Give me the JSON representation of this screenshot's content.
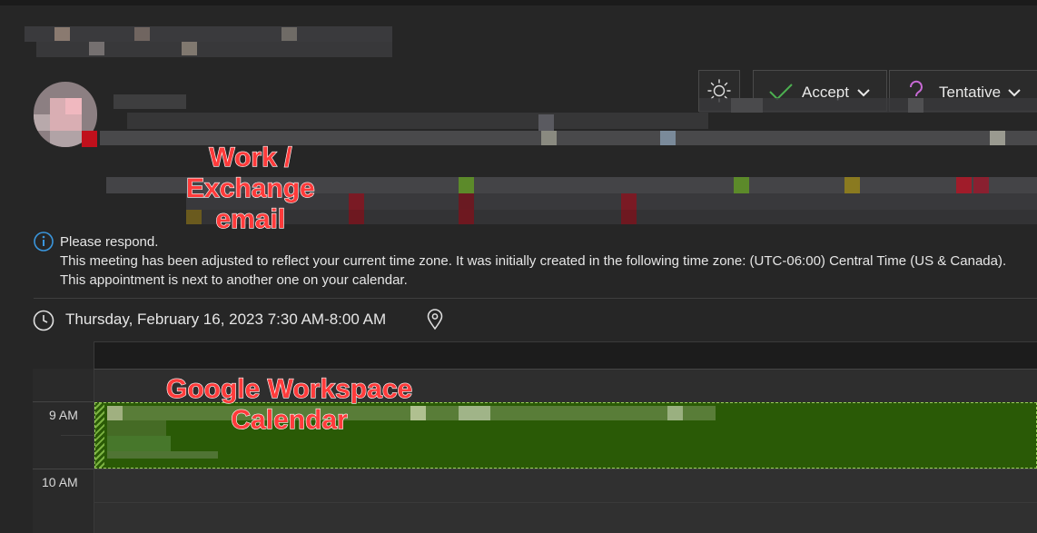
{
  "header": {
    "blurred_title": ""
  },
  "respond_bar": {
    "accept_label": "Accept",
    "tentative_label": "Tentative"
  },
  "info_notes": [
    "Please respond.",
    "This meeting has been adjusted to reflect your current time zone. It was initially created in the following time zone: (UTC-06:00) Central Time (US & Canada).",
    "This appointment is next to another one on your calendar."
  ],
  "meeting": {
    "when": "Thursday, February 16, 2023 7:30 AM-8:00 AM"
  },
  "calendar": {
    "time_labels": [
      "9 AM",
      "10 AM"
    ]
  },
  "annotations": {
    "email_note": "Work /\nExchange\nemail",
    "calendar_note": "Google Workspace\nCalendar"
  },
  "colors": {
    "background": "#262626",
    "event_green": "#2a5a06",
    "annotation_red": "#ff3b3b",
    "accept_check": "#4caf50",
    "tentative_question": "#c86ad6",
    "info_blue": "#3a96dd"
  },
  "icons": [
    "sun-icon",
    "check-icon",
    "question-icon",
    "chevron-down-icon",
    "info-icon",
    "clock-icon",
    "location-pin-icon"
  ]
}
